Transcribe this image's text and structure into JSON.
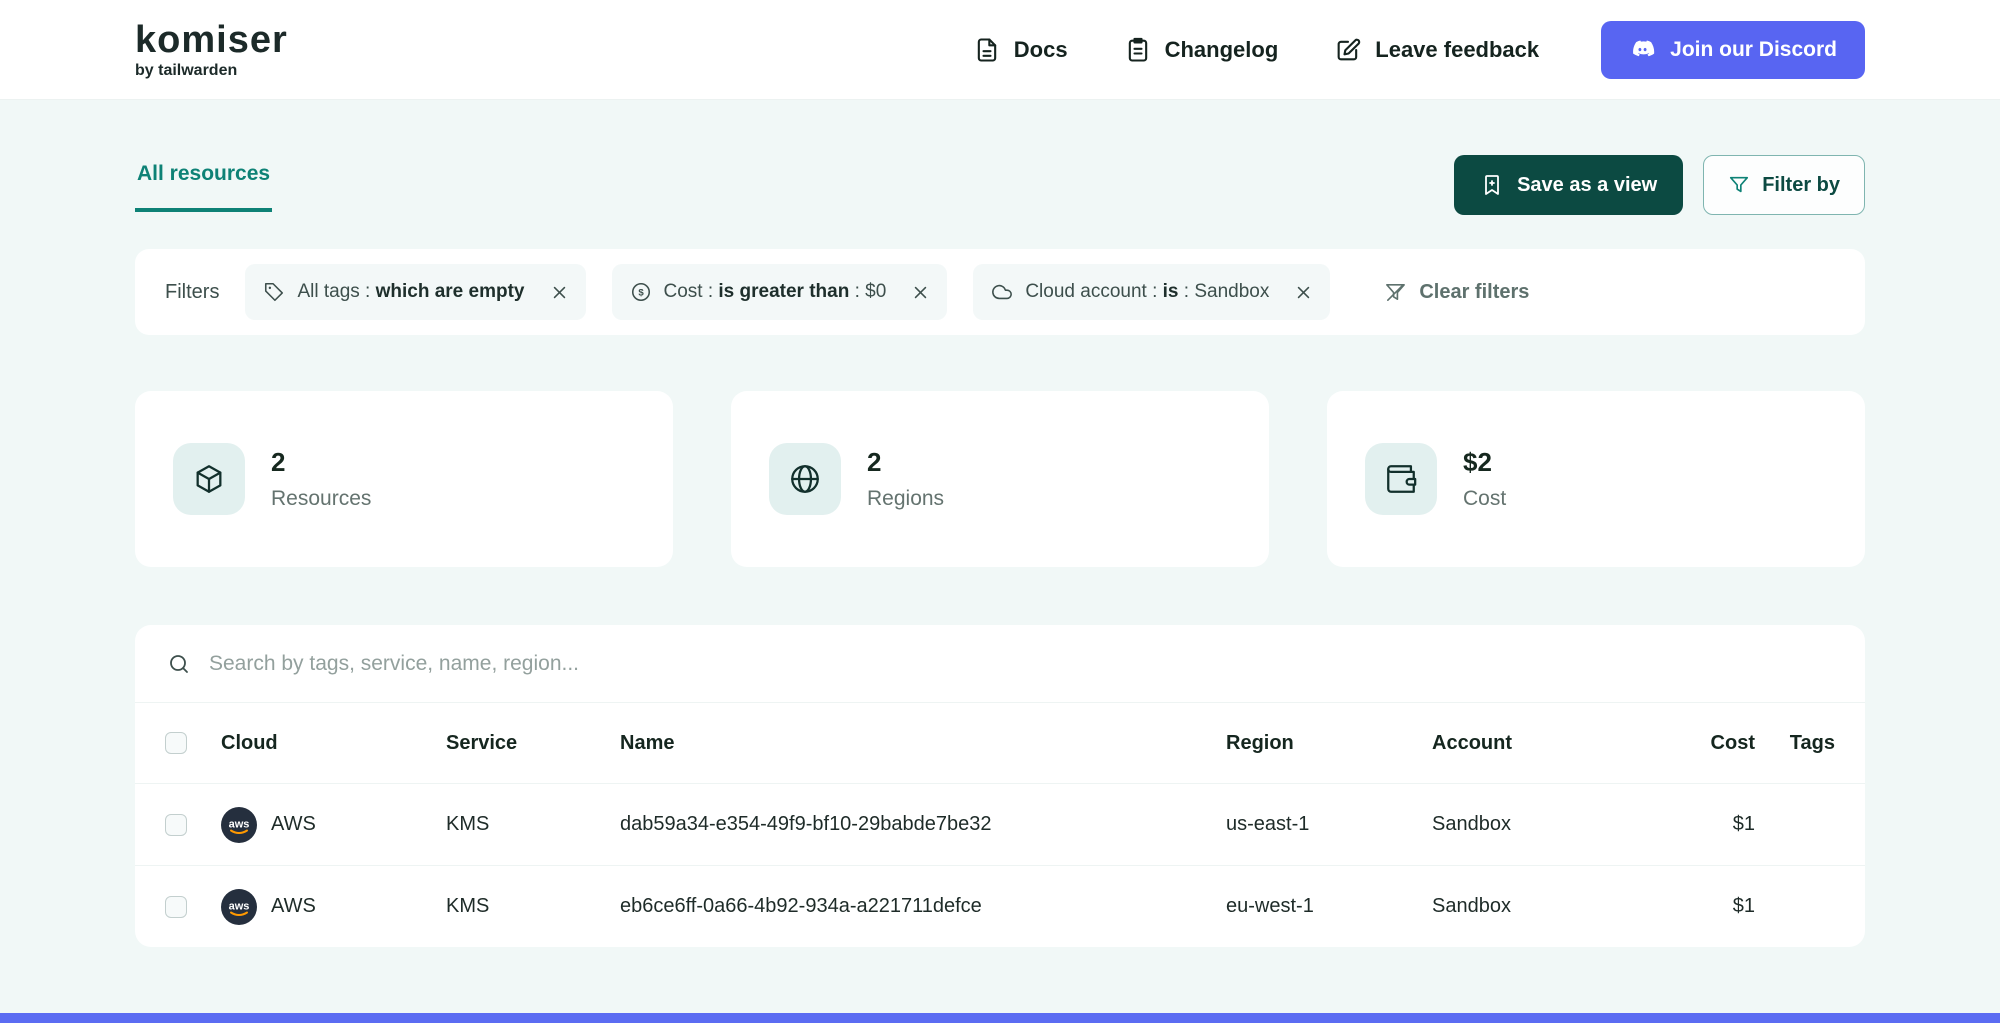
{
  "colors": {
    "accent_teal": "#0E8276",
    "button_dark_teal": "#0C4A42",
    "discord_indigo": "#5865F2",
    "aws_orange": "#FF9900",
    "page_background": "#F1F8F7"
  },
  "header": {
    "logo_title": "komiser",
    "logo_subtitle": "by tailwarden",
    "nav": [
      {
        "label": "Docs"
      },
      {
        "label": "Changelog"
      },
      {
        "label": "Leave feedback"
      }
    ],
    "discord_button": "Join our Discord"
  },
  "toolbar": {
    "active_tab": "All resources",
    "save_view_button": "Save as a view",
    "filter_by_button": "Filter by"
  },
  "filters": {
    "label": "Filters",
    "chips": [
      {
        "prefix": "All tags : ",
        "bold": "which are empty",
        "suffix": ""
      },
      {
        "prefix": "Cost : ",
        "bold": "is greater than",
        "suffix": " : $0"
      },
      {
        "prefix": "Cloud account : ",
        "bold": "is",
        "suffix": " : Sandbox"
      }
    ],
    "clear_label": "Clear filters"
  },
  "stats": [
    {
      "value": "2",
      "label": "Resources"
    },
    {
      "value": "2",
      "label": "Regions"
    },
    {
      "value": "$2",
      "label": "Cost"
    }
  ],
  "table": {
    "search_placeholder": "Search by tags, service, name, region...",
    "aws_logo_text": "aws",
    "columns": [
      "Cloud",
      "Service",
      "Name",
      "Region",
      "Account",
      "Cost",
      "Tags"
    ],
    "rows": [
      {
        "cloud": "AWS",
        "service": "KMS",
        "name": "dab59a34-e354-49f9-bf10-29babde7be32",
        "region": "us-east-1",
        "account": "Sandbox",
        "cost": "$1",
        "tags": ""
      },
      {
        "cloud": "AWS",
        "service": "KMS",
        "name": "eb6ce6ff-0a66-4b92-934a-a221711defce",
        "region": "eu-west-1",
        "account": "Sandbox",
        "cost": "$1",
        "tags": ""
      }
    ]
  }
}
